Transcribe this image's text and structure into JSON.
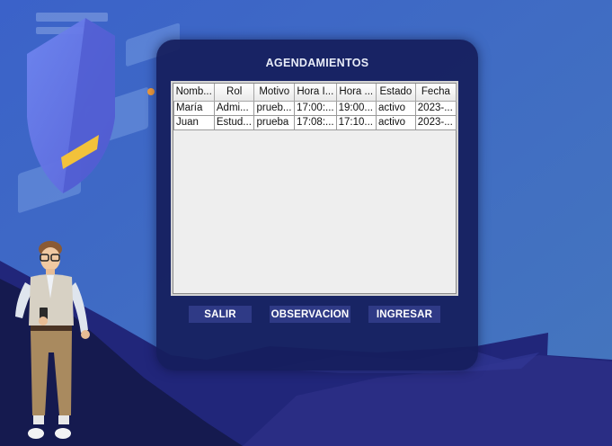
{
  "window": {
    "title": "AGENDAMIENTOS"
  },
  "table": {
    "columns": [
      "Nomb...",
      "Rol",
      "Motivo",
      "Hora I...",
      "Hora ...",
      "Estado",
      "Fecha"
    ],
    "rows": [
      [
        "María",
        "Admi...",
        "prueb...",
        "17:00:...",
        "19:00...",
        "activo",
        "2023-..."
      ],
      [
        "Juan",
        "Estud...",
        "prueba",
        "17:08:...",
        "17:10...",
        "activo",
        "2023-..."
      ]
    ]
  },
  "buttons": {
    "salir": "SALIR",
    "observacion": "OBSERVACION",
    "ingresar": "INGRESAR"
  },
  "colors": {
    "background": "#3d6fbd",
    "panel": "#161e5c",
    "button": "#2f3a86",
    "mountains": "#1f2370"
  },
  "decor": {
    "shield": "shield-icon",
    "person": "person-illustration"
  }
}
